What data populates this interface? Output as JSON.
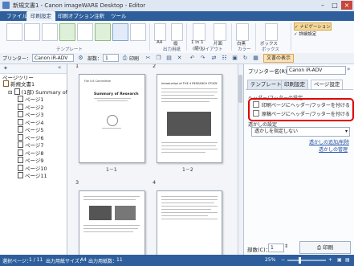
{
  "window": {
    "title": "新規文書1 - Canon imageWARE Desktop - Editor"
  },
  "menu": {
    "items": [
      "ファイル",
      "印刷設定",
      "印刷オプション",
      "注釈",
      "ツール"
    ],
    "active_index": 1
  },
  "ribbon": {
    "groups": [
      "テンプレート",
      "出力用紙",
      "レイアウト",
      "カラー",
      "ボックス"
    ],
    "paper_size": "A4",
    "orientation": "縦",
    "layout": "1 in 1",
    "layout_sub": "(縮小)",
    "sides": "片面",
    "sides_sub": "▾",
    "color": "白黒",
    "box": "ボックス",
    "nav_navigation": "ナビゲーション",
    "nav_detail": "詳細設定"
  },
  "toolbar": {
    "printer_label": "プリンター：",
    "printer_value": "Canon iR-ADV",
    "copies_label": "部数：",
    "copies_value": "1",
    "print_label": "印刷",
    "doc_display_label": "文書の表示"
  },
  "left_panel": {
    "label": "ページツリー",
    "tree": [
      "新規文書1",
      "(1部) Summary of %",
      "ページ1",
      "ページ2",
      "ページ3",
      "ページ4",
      "ページ5",
      "ページ6",
      "ページ7",
      "ページ8",
      "ページ9",
      "ページ10",
      "ページ11"
    ]
  },
  "pages": [
    {
      "num": "1",
      "caption": "1－1",
      "title": "Summary of Research",
      "header": "File 5.6 Committee"
    },
    {
      "num": "2",
      "caption": "1－2",
      "title": "Introduction of THE 4 RESEARCH STUDY"
    },
    {
      "num": "3",
      "caption": ""
    },
    {
      "num": "4",
      "caption": ""
    }
  ],
  "right_panel": {
    "printer_label": "プリンター名(R)：",
    "printer_value": "Canon iR-ADV",
    "tabs": [
      "テンプレート",
      "印刷設定",
      "ページ設定"
    ],
    "active_tab": 2,
    "header_footer_section": "ヘッダー/フッターの設定",
    "checkbox1": "印刷ページにヘッダー/フッターを付ける",
    "checkbox2": "原稿ページにヘッダー/フッターを付ける",
    "overlay_section": "透かしの設定",
    "overlay_value": "透かしを指定しない",
    "link1": "透かしの追加/削除",
    "link2": "透かしの管理",
    "copies_label": "部数(C)：",
    "copies_value": "1",
    "print_button": "印刷"
  },
  "status": {
    "selected_label": "選択ページ：",
    "selected_value": "1 / 11",
    "paper_label": "出力用紙サイズ：",
    "paper_value": "A4",
    "count_label": "出力用紙数：",
    "count_value": "11",
    "zoom": "25%"
  },
  "colors": {
    "menu_bar": "#2e5f9c",
    "highlight": "#e00000"
  }
}
